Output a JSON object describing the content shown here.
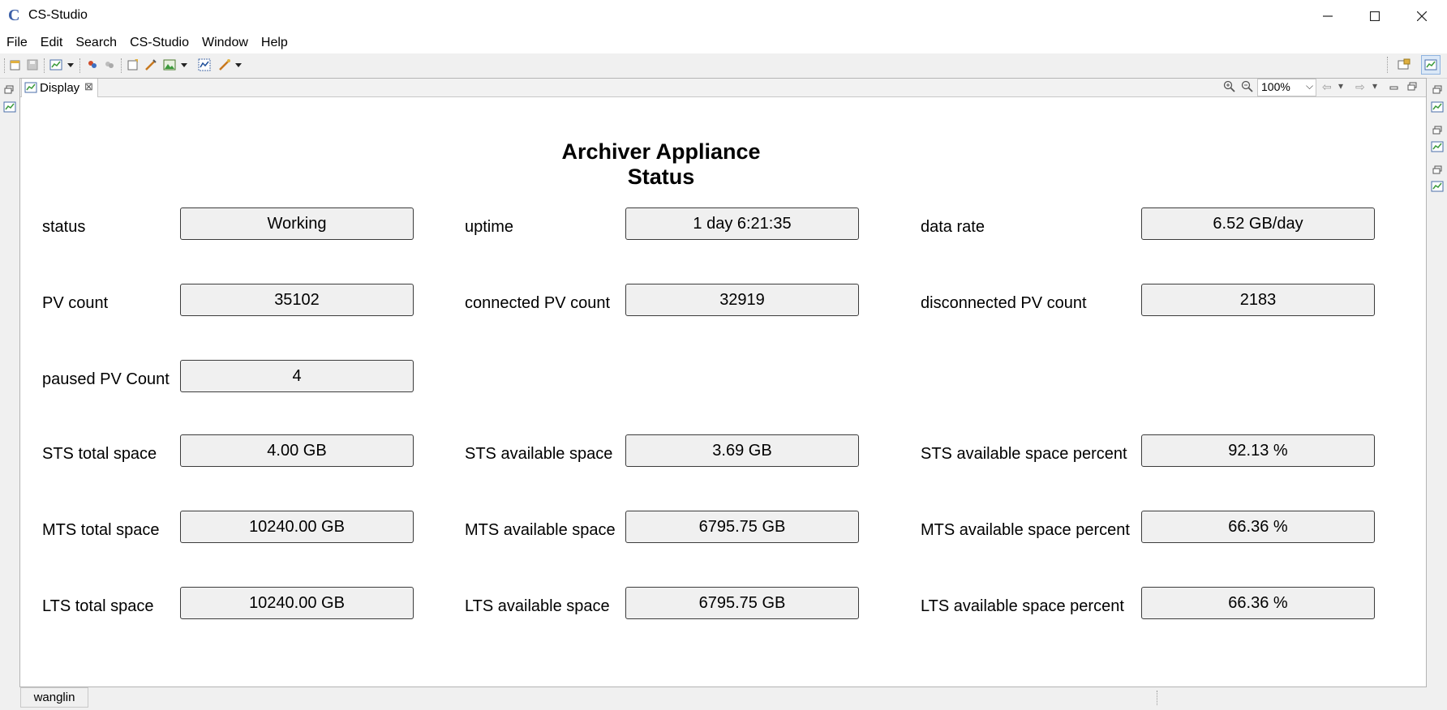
{
  "window": {
    "title": "CS-Studio",
    "logo_glyph": "C",
    "minimize_icon": "minimize-icon",
    "maximize_icon": "maximize-icon",
    "close_icon": "close-icon"
  },
  "menu": {
    "items": [
      {
        "label": "File"
      },
      {
        "label": "Edit"
      },
      {
        "label": "Search"
      },
      {
        "label": "CS-Studio"
      },
      {
        "label": "Window"
      },
      {
        "label": "Help"
      }
    ]
  },
  "editor": {
    "tab_label": "Display",
    "tab_close_glyph": "⊠",
    "zoom_value": "100%",
    "zoom_arrow": "⌵",
    "back_glyph": "⇦",
    "forward_glyph": "⇨",
    "dropdown_glyph": "▾"
  },
  "display": {
    "title": "Archiver Appliance Status",
    "fields": {
      "status": {
        "label": "status",
        "value": "Working"
      },
      "uptime": {
        "label": "uptime",
        "value": "1 day 6:21:35"
      },
      "data_rate": {
        "label": "data rate",
        "value": "6.52 GB/day"
      },
      "pv_count": {
        "label": "PV count",
        "value": "35102"
      },
      "connected_pv_count": {
        "label": "connected PV count",
        "value": "32919"
      },
      "disconnected_pv_count": {
        "label": "disconnected PV count",
        "value": "2183"
      },
      "paused_pv_count": {
        "label": "paused PV Count",
        "value": "4"
      },
      "sts_total_space": {
        "label": "STS total space",
        "value": "4.00 GB"
      },
      "sts_available_space": {
        "label": "STS available space",
        "value": "3.69 GB"
      },
      "sts_available_space_percent": {
        "label": "STS available space percent",
        "value": "92.13 %"
      },
      "mts_total_space": {
        "label": "MTS total space",
        "value": "10240.00 GB"
      },
      "mts_available_space": {
        "label": "MTS available space",
        "value": "6795.75 GB"
      },
      "mts_available_space_percent": {
        "label": "MTS available space percent",
        "value": "66.36 %"
      },
      "lts_total_space": {
        "label": "LTS total space",
        "value": "10240.00 GB"
      },
      "lts_available_space": {
        "label": "LTS available space",
        "value": "6795.75 GB"
      },
      "lts_available_space_percent": {
        "label": "LTS available space percent",
        "value": "66.36 %"
      }
    }
  },
  "statusbar": {
    "user": "wanglin"
  },
  "colors": {
    "chrome": "#f0f0f0",
    "field_border": "#3c3c3c",
    "accent_blue": "#3b5fa8"
  }
}
